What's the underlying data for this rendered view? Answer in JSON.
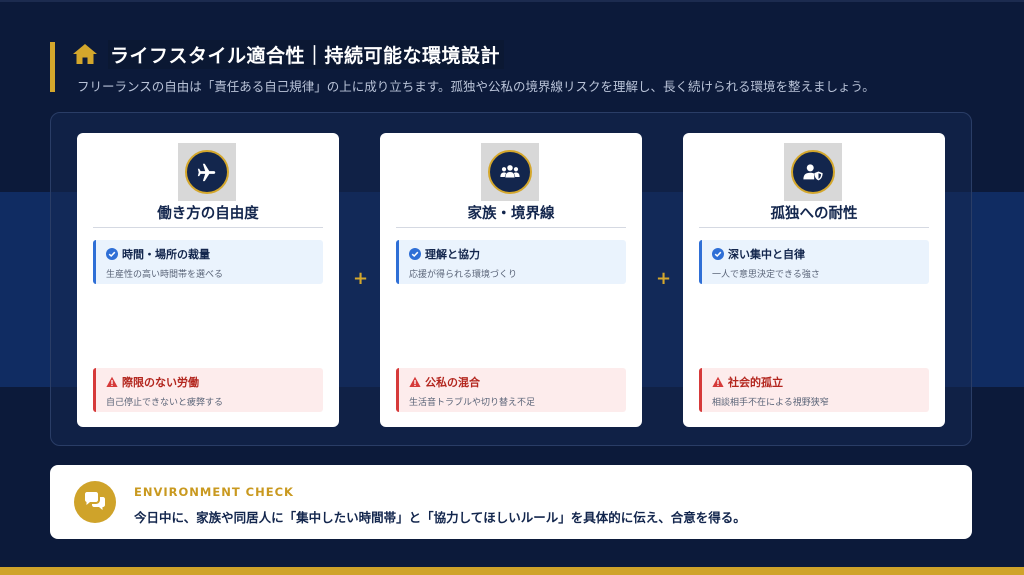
{
  "header": {
    "title": "ライフスタイル適合性｜持続可能な環境設計",
    "subtitle": "フリーランスの自由は「責任ある自己規律」の上に成り立ちます。孤独や公私の境界線リスクを理解し、長く続けられる環境を整えましょう。",
    "icon": "home-icon"
  },
  "cards": [
    {
      "icon": "airplane-icon",
      "title": "働き方の自由度",
      "pro_title": "時間・場所の裁量",
      "pro_desc": "生産性の高い時間帯を選べる",
      "con_title": "際限のない労働",
      "con_desc": "自己停止できないと疲弊する"
    },
    {
      "icon": "family-icon",
      "title": "家族・境界線",
      "pro_title": "理解と協力",
      "pro_desc": "応援が得られる環境づくり",
      "con_title": "公私の混合",
      "con_desc": "生活音トラブルや切り替え不足"
    },
    {
      "icon": "user-shield-icon",
      "title": "孤独への耐性",
      "pro_title": "深い集中と自律",
      "pro_desc": "一人で意思決定できる強さ",
      "con_title": "社会的孤立",
      "con_desc": "相談相手不在による視野狭窄"
    }
  ],
  "plus_symbol": "+",
  "environment_check": {
    "label": "ENVIRONMENT CHECK",
    "text": "今日中に、家族や同居人に「集中したい時間帯」と「協力してほしいルール」を具体的に伝え、合意を得る。",
    "icon": "chat-bubbles-icon"
  },
  "colors": {
    "background": "#0c1a3a",
    "accent_gold": "#d4a72c",
    "navy": "#13264d",
    "pro_blue": "#2f6fd6",
    "con_red": "#d63a3a"
  }
}
